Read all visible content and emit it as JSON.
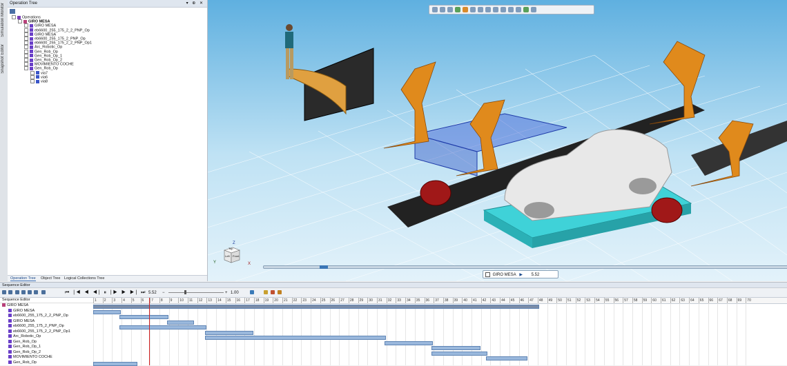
{
  "app": {
    "side_tabs": [
      "Simulation Monitor",
      "Snapshot Editor"
    ]
  },
  "operation_tree": {
    "title": "Operation Tree",
    "controls": "▾ ⊕ ✕",
    "items": [
      {
        "label": "Operations",
        "indent": 0,
        "icon": "op"
      },
      {
        "label": "GIRO MESA",
        "indent": 1,
        "icon": "robot",
        "bold": true
      },
      {
        "label": "GIRO MESA",
        "indent": 2,
        "icon": "gen"
      },
      {
        "label": "eb6600_255_175_2_2_PNP_Op",
        "indent": 2,
        "icon": "gen"
      },
      {
        "label": "GIRO MESA",
        "indent": 2,
        "icon": "gen"
      },
      {
        "label": "eb6600_255_175_2_PNP_Op",
        "indent": 2,
        "icon": "gen"
      },
      {
        "label": "eb6600_255_175_2_2_PNP_Op1",
        "indent": 2,
        "icon": "gen"
      },
      {
        "label": "Arc_Robotic_Op",
        "indent": 2,
        "icon": "gen"
      },
      {
        "label": "Gen_Rob_Op",
        "indent": 2,
        "icon": "gen"
      },
      {
        "label": "Gen_Rob_Op_1",
        "indent": 2,
        "icon": "gen"
      },
      {
        "label": "Gen_Rob_Op_2",
        "indent": 2,
        "icon": "gen"
      },
      {
        "label": "MOVIMIENTO COCHE",
        "indent": 2,
        "icon": "gen"
      },
      {
        "label": "Gen_Rob_Op",
        "indent": 2,
        "icon": "gen"
      },
      {
        "label": "via7",
        "indent": 3,
        "icon": "via"
      },
      {
        "label": "via6",
        "indent": 3,
        "icon": "via"
      },
      {
        "label": "via8",
        "indent": 3,
        "icon": "via"
      }
    ],
    "tabs": [
      "Operation Tree",
      "Object Tree",
      "Logical Collections Tree"
    ]
  },
  "viewport": {
    "nav_cube_labels": [
      "Top",
      "Left",
      "Front"
    ],
    "axis_labels": [
      "Y",
      "Z",
      "X"
    ],
    "playback": {
      "operation": "GIRO MESA",
      "time": "5.52"
    }
  },
  "sequence_editor": {
    "title": "Sequence Editor",
    "time_value": "5.52",
    "speed_value": "1.00",
    "column_header": "Sequence Editor",
    "rows": [
      "GIRO MESA",
      "GIRO MESA",
      "eb6600_255_175_2_2_PNP_Op",
      "GIRO MESA",
      "eb6600_255_175_2_PNP_Op",
      "eb6600_255_175_2_2_PNP_Op1",
      "Arc_Robotic_Op",
      "Gen_Rob_Op",
      "Gen_Rob_Op_1",
      "Gen_Rob_Op_2",
      "MOVIMIENTO COCHE",
      "Gen_Rob_Op"
    ],
    "ruler_ticks": [
      "1",
      "2",
      "3",
      "4",
      "5",
      "6",
      "7",
      "8",
      "9",
      "10",
      "11",
      "12",
      "13",
      "14",
      "15",
      "16",
      "17",
      "18",
      "19",
      "20",
      "21",
      "22",
      "23",
      "24",
      "25",
      "26",
      "27",
      "28",
      "29",
      "30",
      "31",
      "32",
      "33",
      "34",
      "35",
      "36",
      "37",
      "38",
      "39",
      "40",
      "41",
      "42",
      "43",
      "44",
      "45",
      "46",
      "47",
      "48",
      "49",
      "50",
      "51",
      "52",
      "53",
      "54",
      "55",
      "56",
      "57",
      "58",
      "59",
      "60",
      "61",
      "62",
      "63",
      "64",
      "65",
      "66",
      "67",
      "68",
      "69",
      "70"
    ],
    "bars": [
      {
        "row": 0,
        "start": 1,
        "end": 48
      },
      {
        "row": 1,
        "start": 1,
        "end": 3.8
      },
      {
        "row": 2,
        "start": 3.8,
        "end": 8.8
      },
      {
        "row": 3,
        "start": 8.8,
        "end": 11.5
      },
      {
        "row": 4,
        "start": 3.8,
        "end": 12.8
      },
      {
        "row": 5,
        "start": 12.8,
        "end": 17.8
      },
      {
        "row": 6,
        "start": 12.8,
        "end": 31.8
      },
      {
        "row": 7,
        "start": 31.8,
        "end": 36.8
      },
      {
        "row": 8,
        "start": 36.8,
        "end": 41.8
      },
      {
        "row": 9,
        "start": 36.8,
        "end": 42.5
      },
      {
        "row": 10,
        "start": 42.5,
        "end": 46.8
      },
      {
        "row": 11,
        "start": 1,
        "end": 5.5
      }
    ]
  }
}
